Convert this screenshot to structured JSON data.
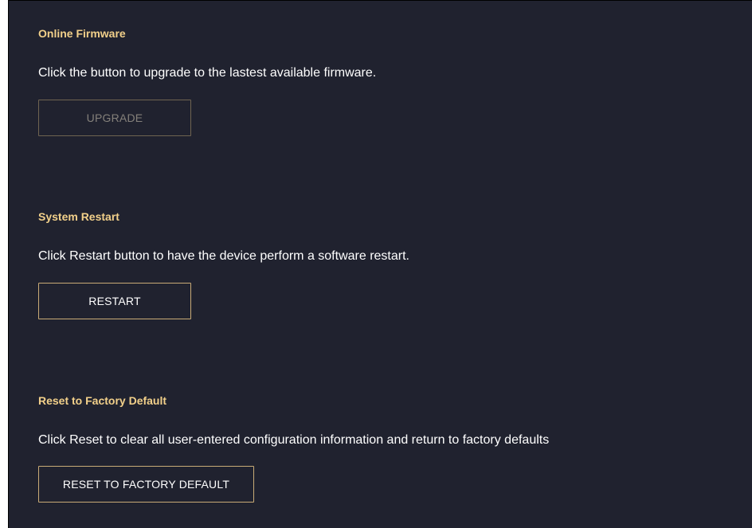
{
  "sections": {
    "online_firmware": {
      "title": "Online Firmware",
      "description": "Click the button to upgrade to the lastest available firmware.",
      "button_label": "UPGRADE",
      "button_disabled": true
    },
    "system_restart": {
      "title": "System Restart",
      "description": "Click Restart button to have the device perform a software restart.",
      "button_label": "RESTART"
    },
    "reset_factory": {
      "title": "Reset to Factory Default",
      "description": "Click Reset to clear all user-entered configuration information and return to factory defaults",
      "button_label": "RESET TO FACTORY DEFAULT"
    }
  },
  "colors": {
    "background": "#20222f",
    "title": "#f2d08a",
    "text": "#ffffff",
    "button_border": "#c9ab76",
    "disabled_text": "#84807a"
  }
}
